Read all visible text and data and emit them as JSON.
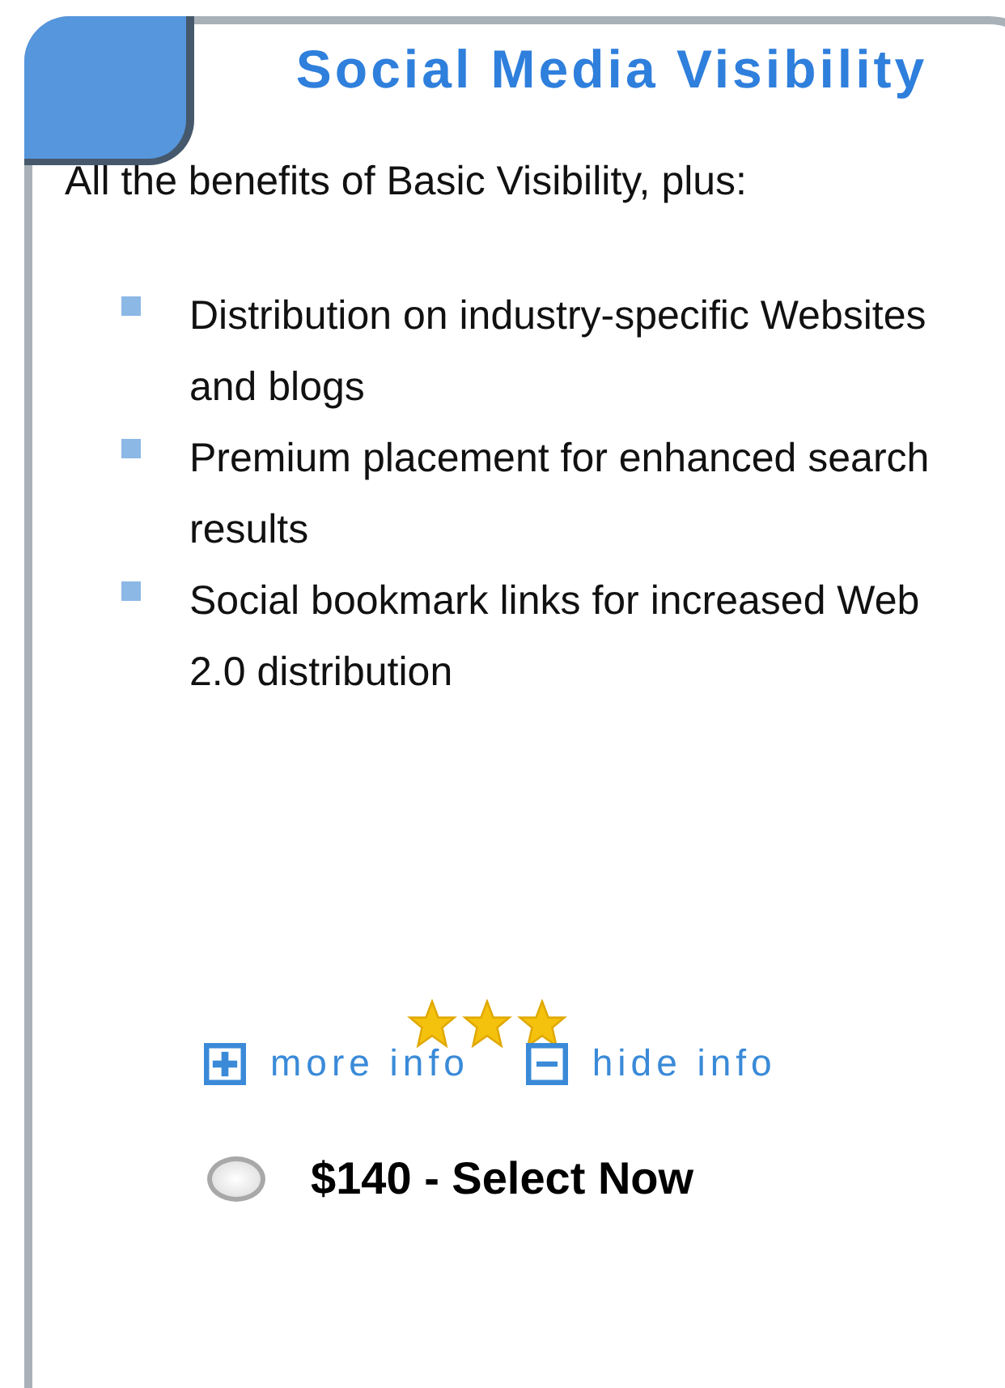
{
  "title": "Social Media Visibility",
  "intro": "All the benefits of Basic Visibility, plus:",
  "benefits": [
    "Distribution on industry-specific Websites and blogs",
    "Premium placement for enhanced search results",
    "Social bookmark links for increased Web 2.0 distribution"
  ],
  "stars": 3,
  "links": [
    {
      "kind": "more",
      "label": "more info"
    },
    {
      "kind": "hide",
      "label": "hide info"
    }
  ],
  "option": {
    "label": "$140 - Select Now",
    "selected": false
  }
}
